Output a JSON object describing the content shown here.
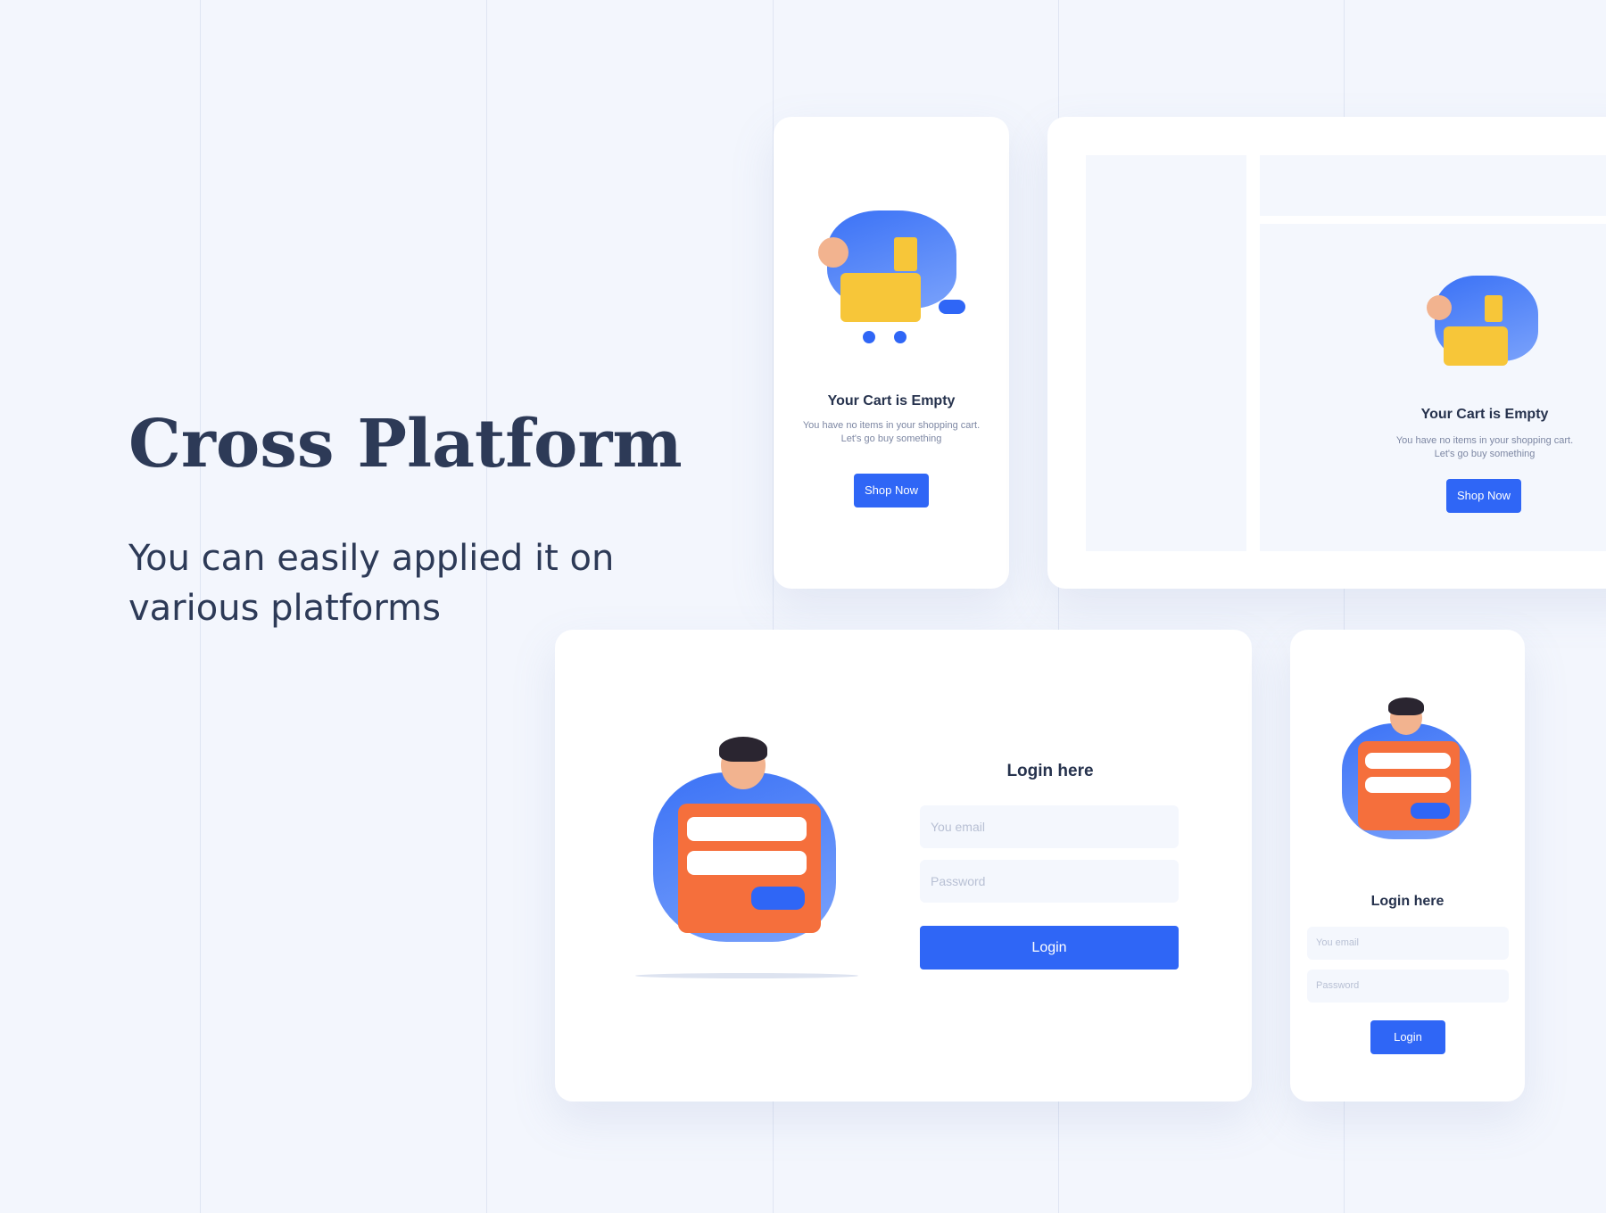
{
  "hero": {
    "title": "Cross Platform",
    "subtitle": "You can easily applied it on various platforms"
  },
  "cart_mobile": {
    "title": "Your Cart is Empty",
    "text_line1": "You have no items in your shopping cart.",
    "text_line2": "Let's go buy something",
    "button": "Shop Now"
  },
  "cart_desktop": {
    "title": "Your Cart is Empty",
    "text_line1": "You have no items in your shopping cart.",
    "text_line2": "Let's go buy something",
    "button": "Shop Now"
  },
  "login_desktop": {
    "title": "Login here",
    "email_placeholder": "You email",
    "password_placeholder": "Password",
    "button": "Login"
  },
  "login_mobile": {
    "title": "Login here",
    "email_placeholder": "You email",
    "password_placeholder": "Password",
    "button": "Login"
  },
  "colors": {
    "accent": "#2f66f6",
    "heading": "#2d3a57",
    "illustration_orange": "#f56f3c"
  }
}
